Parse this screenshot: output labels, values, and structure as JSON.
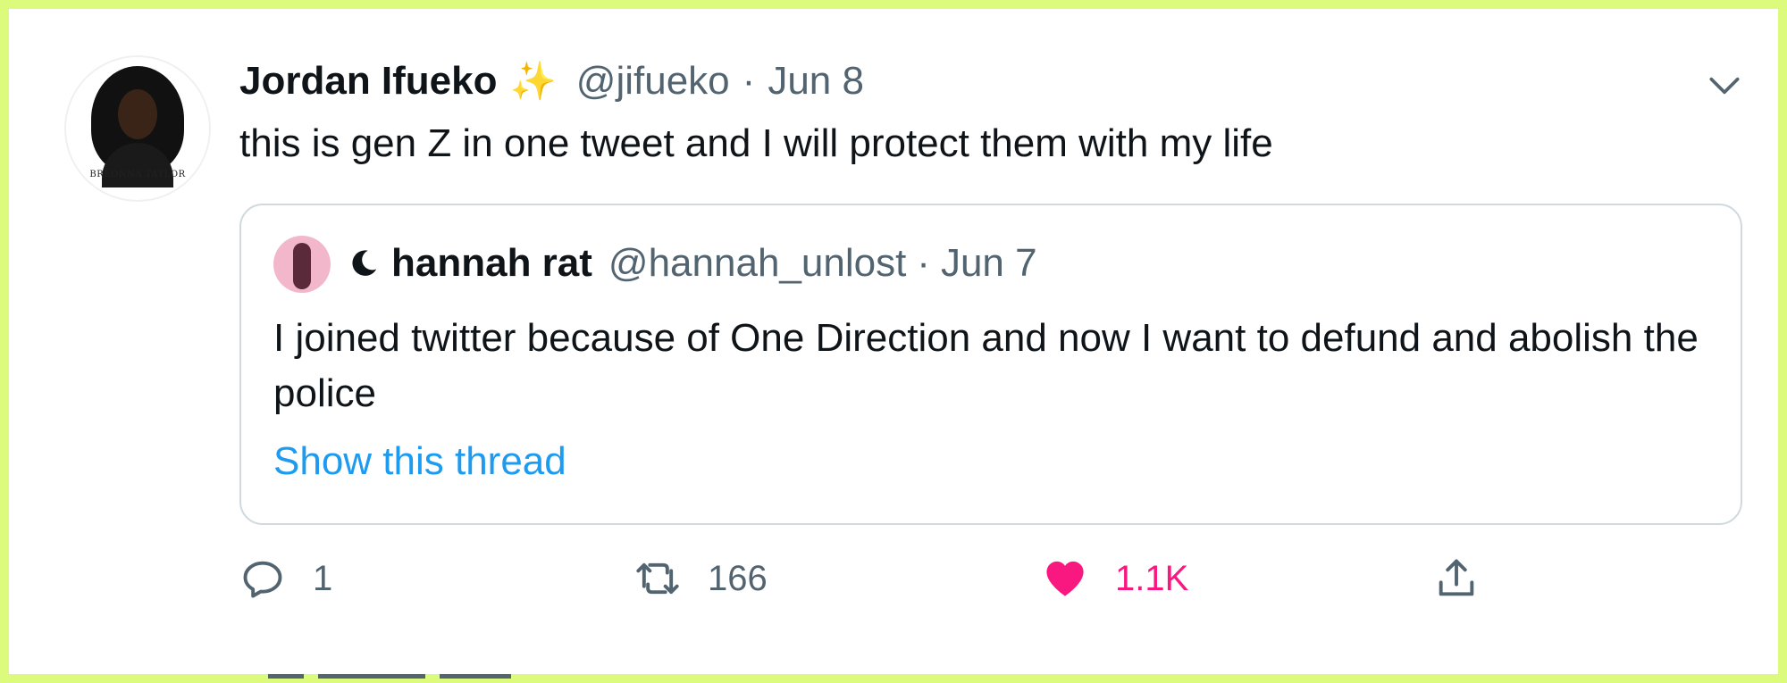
{
  "tweet": {
    "author_name": "Jordan Ifueko",
    "author_emoji": "✨",
    "handle": "@jifueko",
    "separator": "·",
    "date": "Jun 8",
    "text": "this is gen Z in one tweet and I will protect them with my life",
    "avatar_caption": "BREONNA TAYLOR"
  },
  "quoted_tweet": {
    "author_name": "hannah rat",
    "handle": "@hannah_unlost",
    "separator": "·",
    "date": "Jun 7",
    "text": "I joined twitter because of One Direction and now I want to defund and abolish the police",
    "show_thread_label": "Show this thread"
  },
  "actions": {
    "reply_count": "1",
    "retweet_count": "166",
    "like_count": "1.1K"
  },
  "icons": {
    "menu": "chevron-down-icon",
    "reply": "reply-icon",
    "retweet": "retweet-icon",
    "like": "heart-icon",
    "share": "share-icon",
    "quoted_author_badge": "moon-icon"
  },
  "colors": {
    "frame_border": "#dcfb7d",
    "link": "#1d9bf0",
    "like": "#f91880",
    "secondary_text": "#536471"
  }
}
